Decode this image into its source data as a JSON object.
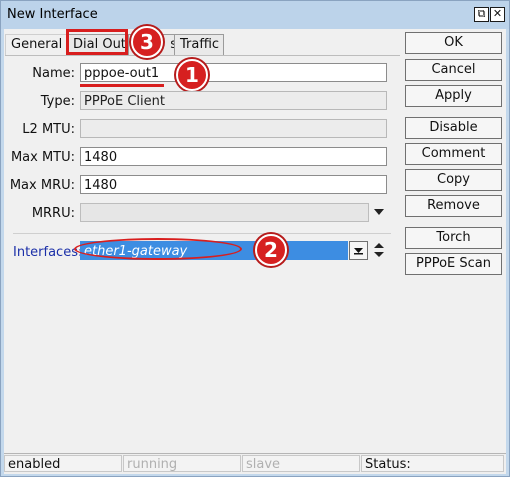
{
  "window": {
    "title": "New Interface",
    "restore_glyph": "⧉",
    "close_glyph": "✕"
  },
  "tabs": [
    {
      "label": "General"
    },
    {
      "label": "Dial Out"
    },
    {
      "label": "s"
    },
    {
      "label": "Traffic"
    }
  ],
  "form": {
    "name": {
      "label": "Name:",
      "value": "pppoe-out1"
    },
    "type": {
      "label": "Type:",
      "value": "PPPoE Client"
    },
    "l2mtu": {
      "label": "L2 MTU:",
      "value": ""
    },
    "maxmtu": {
      "label": "Max MTU:",
      "value": "1480"
    },
    "maxmru": {
      "label": "Max MRU:",
      "value": "1480"
    },
    "mrru": {
      "label": "MRRU:",
      "value": ""
    },
    "interfaces": {
      "label": "Interfaces:",
      "value": "ether1-gateway"
    }
  },
  "buttons": [
    {
      "label": "OK"
    },
    {
      "label": "Cancel"
    },
    {
      "label": "Apply"
    },
    {
      "label": "Disable"
    },
    {
      "label": "Comment"
    },
    {
      "label": "Copy"
    },
    {
      "label": "Remove"
    },
    {
      "label": "Torch"
    },
    {
      "label": "PPPoE Scan"
    }
  ],
  "status": {
    "state": "enabled",
    "running": "running",
    "slave": "slave",
    "status_label": "Status:"
  },
  "annotations": [
    {
      "num": "1"
    },
    {
      "num": "2"
    },
    {
      "num": "3"
    }
  ],
  "colors": {
    "annotation_red": "#d62020",
    "selected_blue": "#3d8de2",
    "title_bar": "#bcd3ea"
  }
}
